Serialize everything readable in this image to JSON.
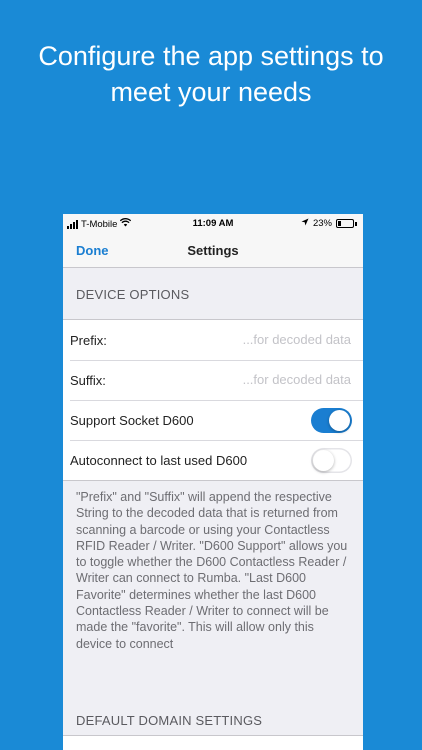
{
  "promo": {
    "headline_line1": "Configure the app settings to",
    "headline_line2": "meet your needs"
  },
  "status_bar": {
    "carrier": "T-Mobile",
    "time": "11:09 AM",
    "battery": "23%"
  },
  "nav": {
    "done_label": "Done",
    "title": "Settings"
  },
  "device_options": {
    "header": "DEVICE OPTIONS",
    "prefix_label": "Prefix:",
    "prefix_placeholder": "...for decoded data",
    "prefix_value": "",
    "suffix_label": "Suffix:",
    "suffix_placeholder": "...for decoded data",
    "suffix_value": "",
    "support_label": "Support Socket D600",
    "support_enabled": true,
    "autoconnect_label": "Autoconnect to last used D600",
    "autoconnect_enabled": false,
    "footnote": "\"Prefix\" and \"Suffix\" will append the respective String to the decoded data that is returned from scanning a barcode or using your Contactless RFID Reader / Writer. \"D600 Support\" allows you to toggle whether the D600 Contactless Reader / Writer can connect to Rumba. \"Last D600 Favorite\" determines whether the last D600 Contactless Reader / Writer to connect will be made the \"favorite\". This will allow only this device to connect"
  },
  "default_domain": {
    "header": "DEFAULT DOMAIN SETTINGS"
  },
  "colors": {
    "background": "#1a8ad6",
    "accent": "#1a7ed1",
    "group_background": "#efeff4"
  },
  "icons": [
    "signal-icon",
    "wifi-icon",
    "location-arrow-icon",
    "battery-icon"
  ]
}
